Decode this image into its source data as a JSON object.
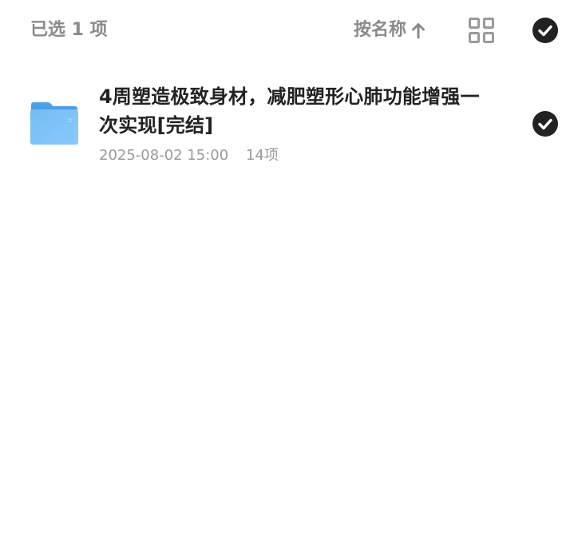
{
  "header": {
    "selected_text": "已选 1 项",
    "sort_label": "按名称",
    "sort_direction_icon": "arrow-up-icon",
    "view_toggle_icon": "grid-view-icon",
    "select_all_icon": "check-circle-icon",
    "select_all_checked": true
  },
  "files": [
    {
      "name": "4周塑造极致身材，减肥塑形心肺功能增强一次实现[完结]",
      "date": "2025-08-02 15:00",
      "count": "14项",
      "icon": "folder-icon",
      "checked": true
    }
  ],
  "colors": {
    "header_text": "#8a8a8a",
    "title_text": "#222222",
    "meta_text": "#9a9a9a",
    "check_fill": "#222222",
    "folder_blue": "#5aaef0",
    "icon_gray": "#9a9a9a"
  }
}
